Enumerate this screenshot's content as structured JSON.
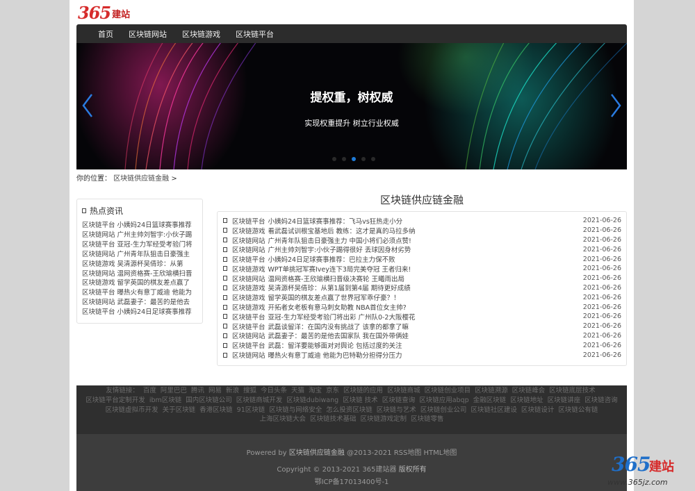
{
  "logo": {
    "number": "365",
    "text": "建站"
  },
  "nav": [
    "首页",
    "区块链网站",
    "区块链游戏",
    "区块链平台"
  ],
  "banner": {
    "title": "提权重，树权威",
    "subtitle": "实现权重提升 树立行业权威",
    "colors": {
      "pink": "#e6288c",
      "teal": "#14a096",
      "dot_active": "#1e7bd8"
    }
  },
  "breadcrumb": {
    "label": "你的位置：",
    "link": "区块链供应链金融",
    "sep": ">"
  },
  "sidebar": {
    "title": "热点资讯",
    "items": [
      "区块链平台 小姨妈24日篮球赛事推荐",
      "区块链网站 广州主帅刘智宇:小伙子踢",
      "区块链平台 亚冠-生力军经受考验门将",
      "区块链网站 广州青年队狙击日豪强主",
      "区块链游戏 吴清源杯吴倩珍：从第",
      "区块链网站 温网资格赛-王欣瑜横扫晋",
      "区块链游戏 留学英国的棋友差点赢了",
      "区块链平台 曝热火有意丁威迪 他能为",
      "区块链网站 武磊妻子：最苦的是他去",
      "区块链平台 小姨妈24日足球赛事推荐"
    ]
  },
  "main": {
    "title": "区块链供应链金融",
    "rows": [
      {
        "cat": "区块链平台",
        "text": "小姨妈24日篮球赛事推荐：飞马vs狂热走小分",
        "date": "2021-06-26"
      },
      {
        "cat": "区块链游戏",
        "text": "看武磊试训根宝基地后 教练：这才是真的马拉多纳",
        "date": "2021-06-26"
      },
      {
        "cat": "区块链网站",
        "text": "广州青年队狙击日豪强主力 中国小将们必须点赞!",
        "date": "2021-06-26"
      },
      {
        "cat": "区块链网站",
        "text": "广州主帅刘智宇:小伙子踢得很好 丢球因身材劣势",
        "date": "2021-06-26"
      },
      {
        "cat": "区块链平台",
        "text": "小姨妈24日足球赛事推荐：巴拉主力保不败",
        "date": "2021-06-26"
      },
      {
        "cat": "区块链游戏",
        "text": "WPT单挑冠军赛Ivey连下3局完美夺冠 王者归来!",
        "date": "2021-06-26"
      },
      {
        "cat": "区块链网站",
        "text": "温网资格赛-王欣瑜横扫晋级决赛轮 王曦雨出局",
        "date": "2021-06-26"
      },
      {
        "cat": "区块链游戏",
        "text": "吴清源杯吴倩珍：从第1届到第4届 期待更好成绩",
        "date": "2021-06-26"
      },
      {
        "cat": "区块链游戏",
        "text": "留学英国的棋友差点赢了世界冠军乖仔豪？！",
        "date": "2021-06-26"
      },
      {
        "cat": "区块链游戏",
        "text": "开拓者女老板有意马刺女助教 NBA首位女主帅?",
        "date": "2021-06-26"
      },
      {
        "cat": "区块链平台",
        "text": "亚冠-生力军经受考验门将出彩 广州队0-2大阪樱花",
        "date": "2021-06-26"
      },
      {
        "cat": "区块链平台",
        "text": "武磊谈留洋：在国内没有挑战了 该拿的都拿了嘛",
        "date": "2021-06-26"
      },
      {
        "cat": "区块链网站",
        "text": "武磊妻子：最苦的是他去国家队 我在国外带俩娃",
        "date": "2021-06-26"
      },
      {
        "cat": "区块链平台",
        "text": "武磊：留洋要能够面对对舆论 包括过度的关注",
        "date": "2021-06-26"
      },
      {
        "cat": "区块链网站",
        "text": "曝热火有意丁威迪 他能为巴特勒分担得分压力",
        "date": "2021-06-26"
      }
    ]
  },
  "links": {
    "label": "友情链接：",
    "line1": [
      "百度",
      "阿里巴巴",
      "腾讯",
      "网易",
      "新浪",
      "搜狐",
      "今日头条",
      "天猫",
      "淘宝",
      "京东",
      "区块链的应用",
      "区块链商城",
      "区块链创业项目",
      "区块链溯源",
      "区块链峰会",
      "区块链底层技术"
    ],
    "line2": [
      "区块链平台定制开发",
      "ibm区块链",
      "国内区块链公司",
      "区块链商城开发",
      "区块链dubiwang",
      "区块链 技术",
      "区块链查询",
      "区块链应用abqp",
      "金融区块链",
      "区块链地址",
      "区块链讲座",
      "区块链咨询"
    ],
    "line3": [
      "区块链虚拟币开发",
      "关于区块链",
      "香港区块链",
      "91区块链",
      "区块链与网络安全",
      "怎么投资区块链",
      "区块链与艺术",
      "区块链创业公司",
      "区块链社区建设",
      "区块链设计",
      "区块链公有链"
    ],
    "line4": [
      "上海区块链大会",
      "区块链技术基础",
      "区块链游戏定制",
      "区块链零售"
    ]
  },
  "footer": {
    "powered_prefix": "Powered by",
    "powered_site": "区块链供应链金融",
    "powered_year": "@2013-2021",
    "rss": "RSS地图",
    "html": "HTML地图",
    "copyright_prefix": "Copyright © 2013-2021",
    "copyright_brand": "365建站器",
    "copyright_suffix": "版权所有",
    "icp": "鄂ICP备17013400号-1"
  },
  "watermark": {
    "number": "365",
    "text": "建站",
    "url": "www.365jz.com"
  }
}
